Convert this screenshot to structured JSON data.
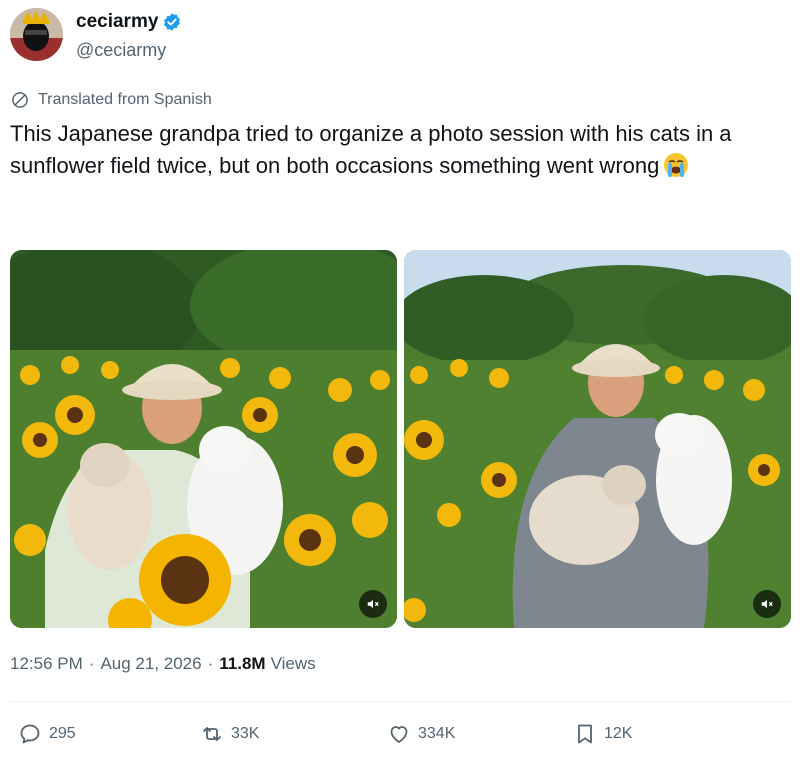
{
  "author": {
    "display_name": "ceciarmy",
    "handle": "@ceciarmy",
    "verified": true,
    "avatar_icon": "masked-person-crown-avatar"
  },
  "translation_note": "Translated from Spanish",
  "tweet_text": "This Japanese grandpa tried to organize a photo session with his cats in a sunflower field twice, but on both occasions something went wrong",
  "tweet_emoji": "loudly-crying-face",
  "media": [
    {
      "description_icon": "video-thumbnail",
      "muted": true
    },
    {
      "description_icon": "video-thumbnail",
      "muted": true
    }
  ],
  "meta": {
    "time": "12:56 PM",
    "separator": "·",
    "date": "Aug 21, 2026",
    "views_count": "11.8M",
    "views_label": "Views"
  },
  "actions": {
    "replies": "295",
    "reposts": "33K",
    "likes": "334K",
    "bookmarks": "12K"
  },
  "colors": {
    "text_primary": "#0f1419",
    "text_secondary": "#536471",
    "verified_blue": "#1d9bf0"
  }
}
